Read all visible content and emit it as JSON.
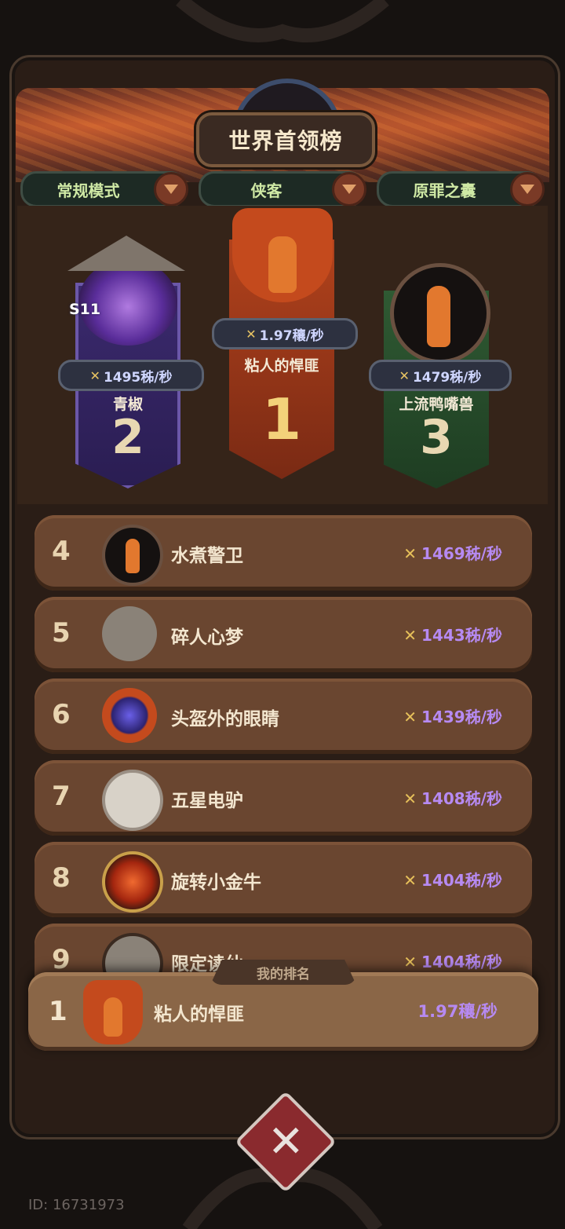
{
  "title": "世界首领榜",
  "filters": [
    {
      "label": "常规模式"
    },
    {
      "label": "侠客"
    },
    {
      "label": "原罪之囊"
    }
  ],
  "podium": [
    {
      "rank": "2",
      "name": "青椒",
      "score": "1495秭/秒",
      "badge": "S11",
      "color": "#3b2a6e"
    },
    {
      "rank": "1",
      "name": "粘人的悍匪",
      "score": "1.97穰/秒",
      "color": "#b1421c"
    },
    {
      "rank": "3",
      "name": "上流鸭嘴兽",
      "score": "1479秭/秒",
      "color": "#2f5a33"
    }
  ],
  "rows": [
    {
      "rank": "4",
      "name": "水煮警卫",
      "score": "1469秭/秒",
      "avatar": "carrot-avatar"
    },
    {
      "rank": "5",
      "name": "碎人心梦",
      "score": "1443秭/秒",
      "avatar": "hat-avatar"
    },
    {
      "rank": "6",
      "name": "头盔外的眼睛",
      "score": "1439秭/秒",
      "avatar": "orb-avatar"
    },
    {
      "rank": "7",
      "name": "五星电驴",
      "score": "1408秭/秒",
      "avatar": "horned-avatar"
    },
    {
      "rank": "8",
      "name": "旋转小金牛",
      "score": "1404秭/秒",
      "avatar": "swirl-avatar"
    },
    {
      "rank": "9",
      "name": "限定读仙",
      "score": "1404秭/秒",
      "avatar": "hat-avatar"
    }
  ],
  "my_rank": {
    "label": "我的排名",
    "rank": "1",
    "name": "粘人的悍匪",
    "score": "1.97穰/秒"
  },
  "user_id": "ID: 16731973",
  "icons": {
    "swords": "crossed-swords-icon",
    "close": "close-x-icon",
    "dropdown": "chevron-down-icon"
  }
}
